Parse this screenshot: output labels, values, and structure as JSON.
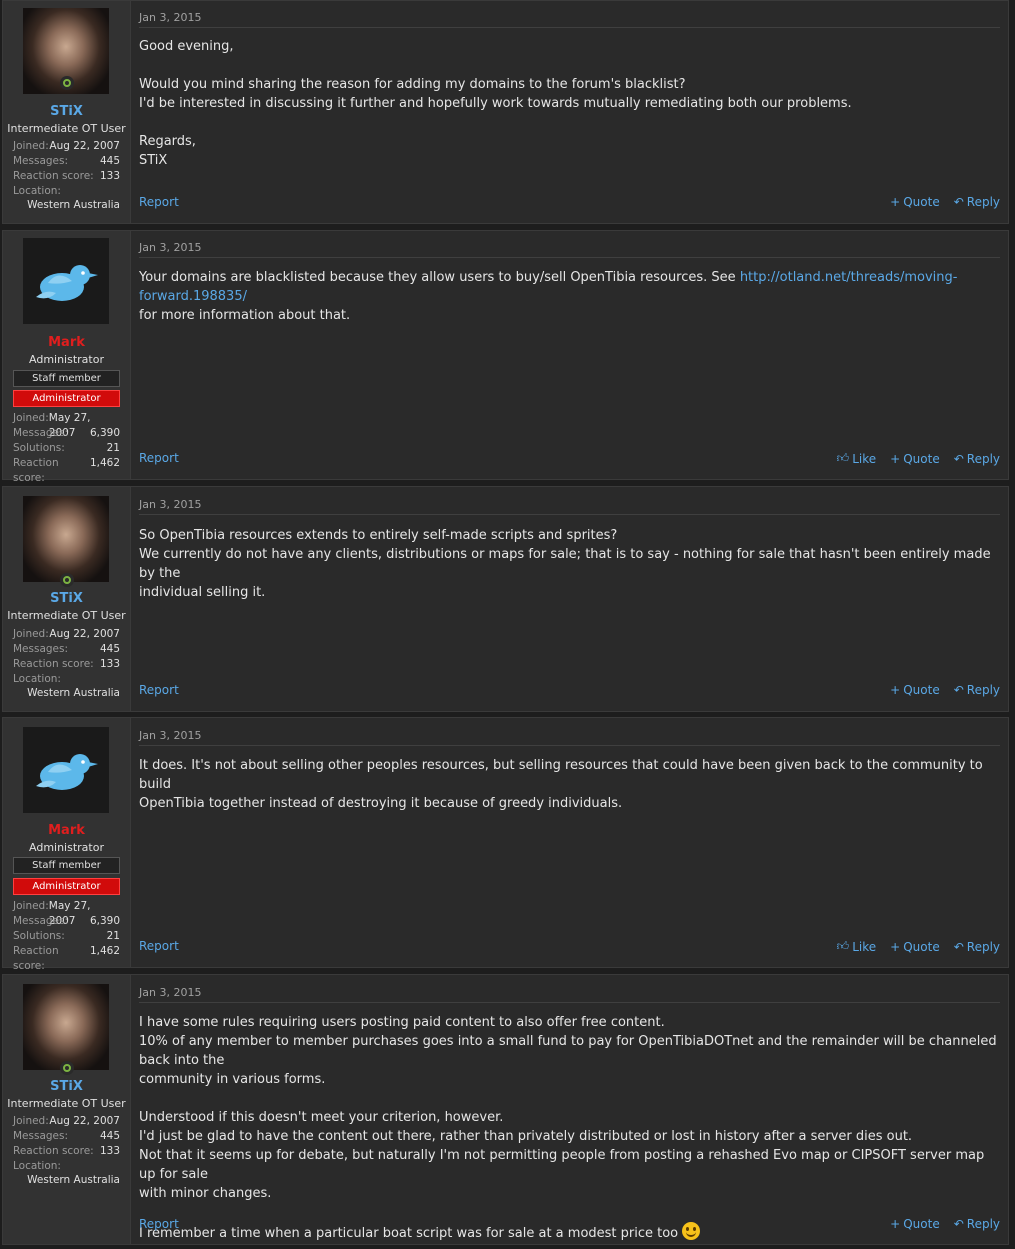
{
  "posts": [
    {
      "user": {
        "name": "STiX",
        "title": "Intermediate OT User",
        "joined_label": "Joined:",
        "joined": "Aug 22, 2007",
        "messages_label": "Messages:",
        "messages": "445",
        "reaction_label": "Reaction score:",
        "reaction": "133",
        "location_label": "Location:",
        "location": "Western Australia"
      },
      "date": "Jan 3, 2015",
      "lines": [
        "Good evening,",
        "",
        "Would you mind sharing the reason for adding my domains to the forum's blacklist?",
        "I'd be interested in discussing it further and hopefully work towards mutually remediating both our problems.",
        "",
        "Regards,",
        "STiX"
      ],
      "report": "Report",
      "quote": "Quote",
      "reply": "Reply"
    },
    {
      "user": {
        "name": "Mark",
        "title": "Administrator",
        "banner_staff": "Staff member",
        "banner_admin": "Administrator",
        "joined_label": "Joined:",
        "joined": "May 27, 2007",
        "messages_label": "Messages:",
        "messages": "6,390",
        "solutions_label": "Solutions:",
        "solutions": "21",
        "reaction_label": "Reaction score:",
        "reaction": "1,462"
      },
      "date": "Jan 3, 2015",
      "text_before": "Your domains are blacklisted because they allow users to buy/sell OpenTibia resources. See ",
      "link": "http://otland.net/threads/moving-forward.198835/",
      "text_after": "for more information about that.",
      "report": "Report",
      "like": "Like",
      "quote": "Quote",
      "reply": "Reply"
    },
    {
      "user": {
        "name": "STiX",
        "title": "Intermediate OT User",
        "joined_label": "Joined:",
        "joined": "Aug 22, 2007",
        "messages_label": "Messages:",
        "messages": "445",
        "reaction_label": "Reaction score:",
        "reaction": "133",
        "location_label": "Location:",
        "location": "Western Australia"
      },
      "date": "Jan 3, 2015",
      "lines": [
        "So OpenTibia resources extends to entirely self-made scripts and sprites?",
        "We currently do not have any clients, distributions or maps for sale; that is to say - nothing for sale that hasn't been entirely made by the",
        "individual selling it."
      ],
      "report": "Report",
      "quote": "Quote",
      "reply": "Reply"
    },
    {
      "user": {
        "name": "Mark",
        "title": "Administrator",
        "banner_staff": "Staff member",
        "banner_admin": "Administrator",
        "joined_label": "Joined:",
        "joined": "May 27, 2007",
        "messages_label": "Messages:",
        "messages": "6,390",
        "solutions_label": "Solutions:",
        "solutions": "21",
        "reaction_label": "Reaction score:",
        "reaction": "1,462"
      },
      "date": "Jan 3, 2015",
      "lines": [
        "It does. It's not about selling other peoples resources, but selling resources that could have been given back to the community to build",
        "OpenTibia together instead of destroying it because of greedy individuals."
      ],
      "report": "Report",
      "like": "Like",
      "quote": "Quote",
      "reply": "Reply"
    },
    {
      "user": {
        "name": "STiX",
        "title": "Intermediate OT User",
        "joined_label": "Joined:",
        "joined": "Aug 22, 2007",
        "messages_label": "Messages:",
        "messages": "445",
        "reaction_label": "Reaction score:",
        "reaction": "133",
        "location_label": "Location:",
        "location": "Western Australia"
      },
      "date": "Jan 3, 2015",
      "lines": [
        "I have some rules requiring users posting paid content to also offer free content.",
        "10% of any member to member purchases goes into a small fund to pay for OpenTibiaDOTnet and the remainder will be channeled back into the",
        "community in various forms.",
        "",
        "Understood if this doesn't meet your criterion, however.",
        "I'd just be glad to have the content out there, rather than privately distributed or lost in history after a server dies out.",
        "Not that it seems up for debate, but naturally I'm not permitting people from posting a rehashed Evo map or CIPSOFT server map up for sale",
        "with minor changes.",
        ""
      ],
      "last_line": "I remember a time when a particular boat script was for sale at a modest price too ",
      "report": "Report",
      "quote": "Quote",
      "reply": "Reply"
    }
  ]
}
